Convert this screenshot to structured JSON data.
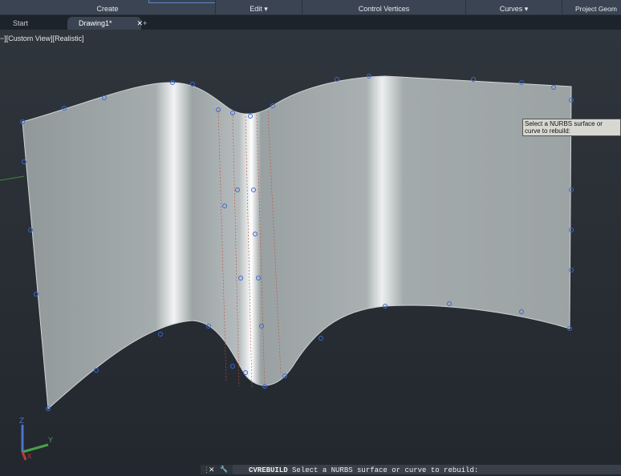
{
  "ribbon": {
    "panels": [
      "Create",
      "Edit ▾",
      "Control Vertices",
      "Curves ▾",
      "Project Geom"
    ]
  },
  "tabs": {
    "start": "Start",
    "drawing": "Drawing1*",
    "close": "✕",
    "add": "+"
  },
  "viewport": {
    "label": "−][Custom View][Realistic]",
    "tooltip": "Select a NURBS surface or curve to rebuild:"
  },
  "ucs": {
    "z": "Z",
    "y": "Y",
    "x": "X"
  },
  "command": {
    "command": "CVREBUILD",
    "prompt": "Select a NURBS surface or curve to rebuild:",
    "close": "✕",
    "wrench": "🔧"
  }
}
